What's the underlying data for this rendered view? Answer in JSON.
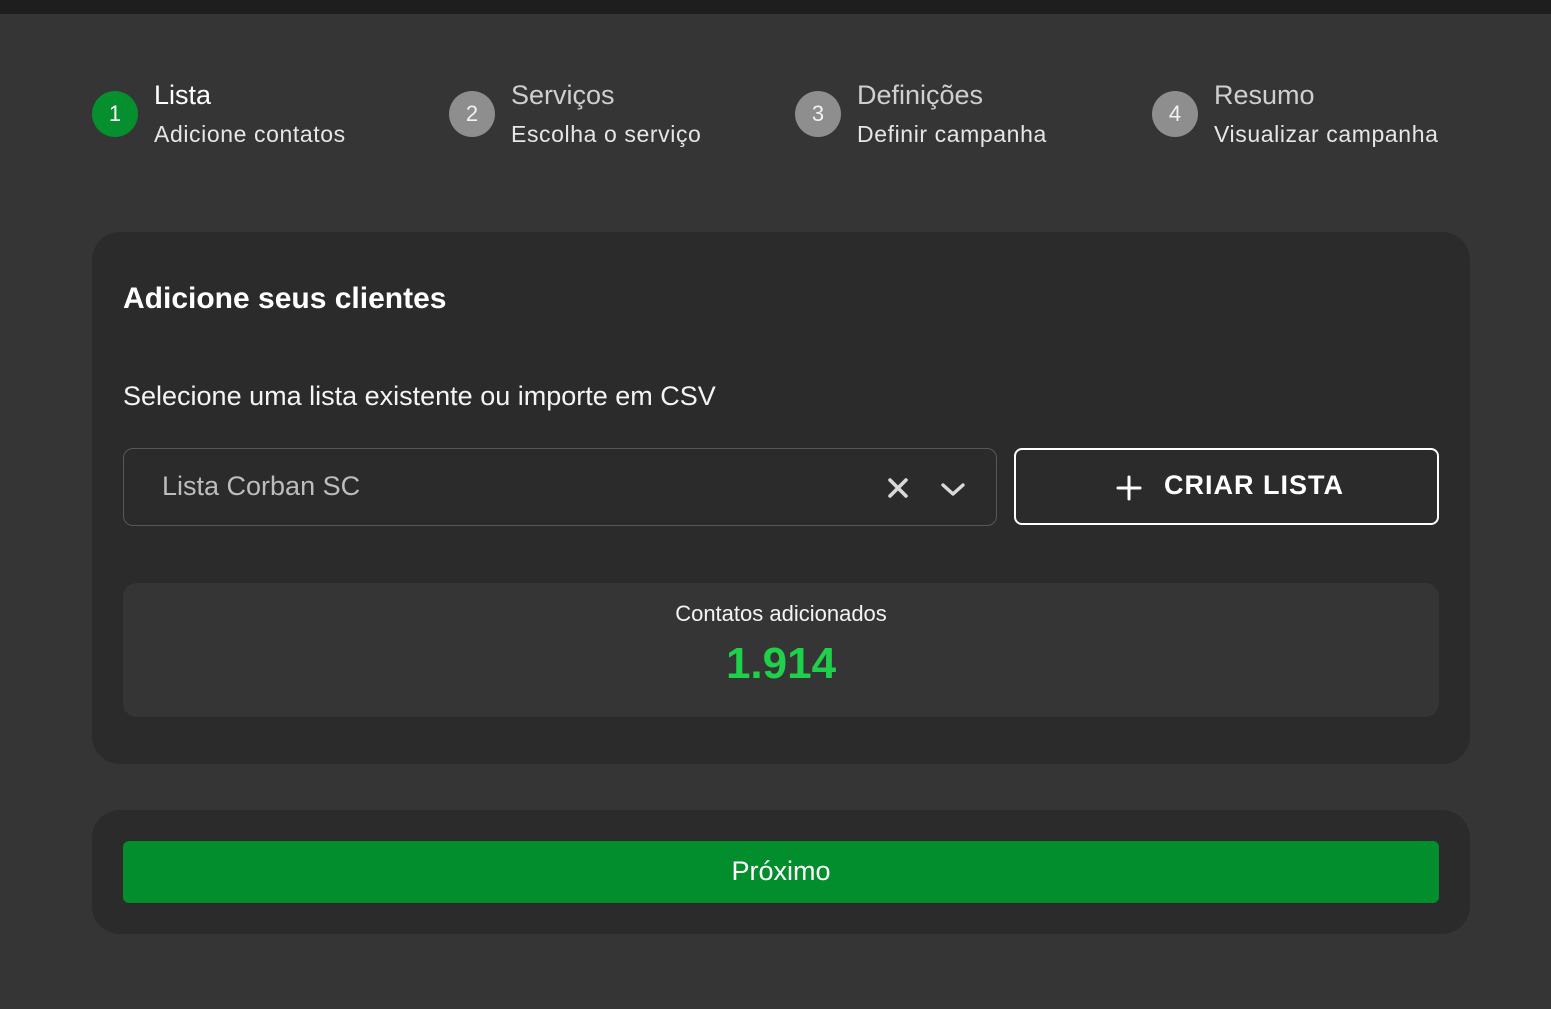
{
  "stepper": {
    "steps": [
      {
        "number": "1",
        "title": "Lista",
        "subtitle": "Adicione contatos",
        "active": true
      },
      {
        "number": "2",
        "title": "Serviços",
        "subtitle": "Escolha o serviço",
        "active": false
      },
      {
        "number": "3",
        "title": "Definições",
        "subtitle": "Definir campanha",
        "active": false
      },
      {
        "number": "4",
        "title": "Resumo",
        "subtitle": "Visualizar campanha",
        "active": false
      }
    ]
  },
  "card": {
    "title": "Adicione seus clientes",
    "subtitle": "Selecione uma lista existente ou importe em CSV",
    "select": {
      "value": "Lista Corban SC",
      "clear_icon": "close-icon",
      "dropdown_icon": "chevron-down-icon"
    },
    "create_button": {
      "icon": "plus-icon",
      "label": "CRIAR LISTA"
    },
    "stats": {
      "label": "Contatos adicionados",
      "value": "1.914"
    }
  },
  "footer": {
    "next_label": "Próximo"
  },
  "colors": {
    "background": "#353535",
    "card": "#2b2b2b",
    "active_step": "#058f2e",
    "inactive_step": "#8e8e8e",
    "accent_green": "#1ed04a",
    "button_green": "#038e2e"
  }
}
